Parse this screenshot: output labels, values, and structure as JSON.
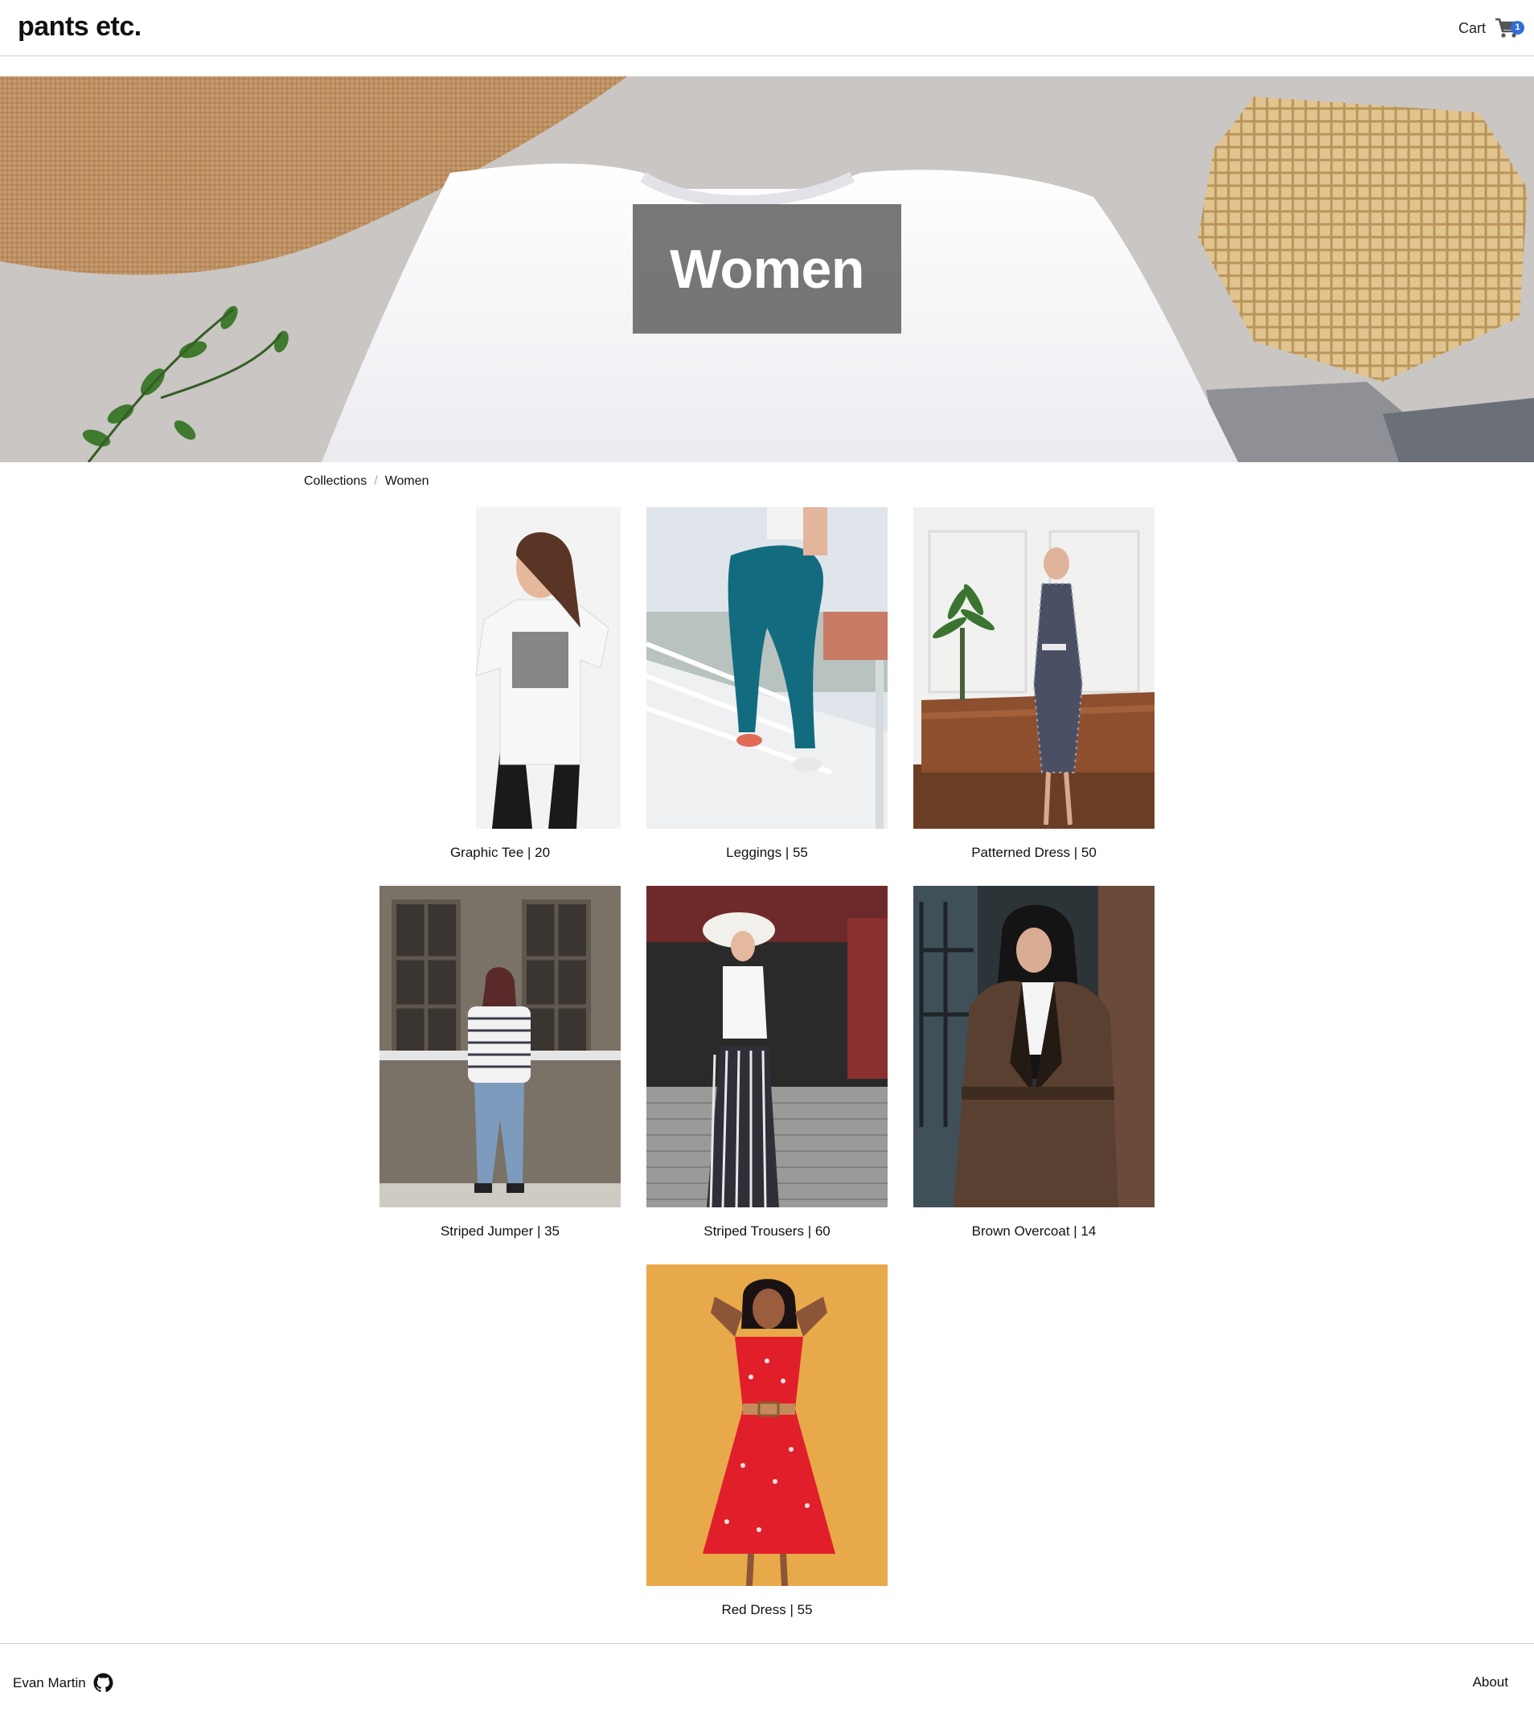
{
  "header": {
    "logo": "pants etc.",
    "cart_label": "Cart",
    "cart_count": "1"
  },
  "hero": {
    "title": "Women"
  },
  "breadcrumb": {
    "items": [
      "Collections",
      "Women"
    ],
    "separator": "/"
  },
  "products": [
    {
      "name": "Graphic Tee",
      "price": "20",
      "caption": "Graphic Tee | 20"
    },
    {
      "name": "Leggings",
      "price": "55",
      "caption": "Leggings | 55"
    },
    {
      "name": "Patterned Dress",
      "price": "50",
      "caption": "Patterned Dress | 50"
    },
    {
      "name": "Striped Jumper",
      "price": "35",
      "caption": "Striped Jumper | 35"
    },
    {
      "name": "Striped Trousers",
      "price": "60",
      "caption": "Striped Trousers | 60"
    },
    {
      "name": "Brown Overcoat",
      "price": "14",
      "caption": "Brown Overcoat | 14"
    },
    {
      "name": "Red Dress",
      "price": "55",
      "caption": "Red Dress | 55"
    }
  ],
  "footer": {
    "author": "Evan Martin",
    "about": "About",
    "icon": "github-icon"
  },
  "colors": {
    "badge": "#2f6fd6",
    "hero_overlay": "#646464"
  }
}
